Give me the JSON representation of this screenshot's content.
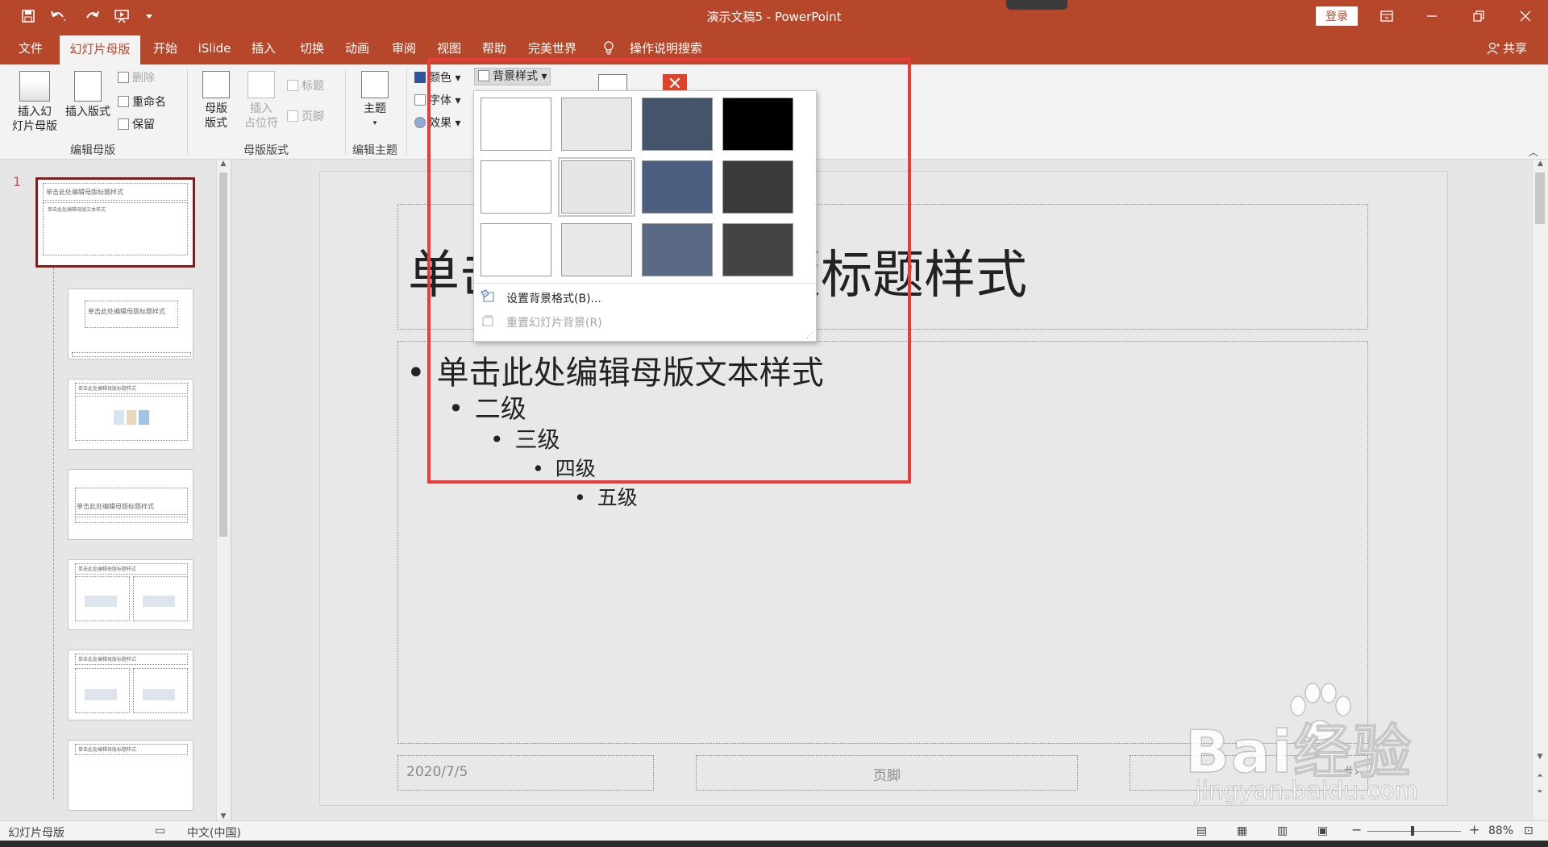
{
  "window": {
    "title": "演示文稿5 - PowerPoint",
    "login_label": "登录",
    "share_label": "共享"
  },
  "tabs": [
    {
      "label": "文件"
    },
    {
      "label": "幻灯片母版"
    },
    {
      "label": "开始"
    },
    {
      "label": "iSlide"
    },
    {
      "label": "插入"
    },
    {
      "label": "切换"
    },
    {
      "label": "动画"
    },
    {
      "label": "审阅"
    },
    {
      "label": "视图"
    },
    {
      "label": "帮助"
    },
    {
      "label": "完美世界"
    },
    {
      "label": "操作说明搜索"
    }
  ],
  "ribbon": {
    "insert_master": "插入幻\n灯片母版",
    "insert_layout": "插入版式",
    "delete": "删除",
    "rename": "重命名",
    "preserve": "保留",
    "group_edit_master": "编辑母版",
    "master_layout": "母版\n版式",
    "insert_placeholder": "插入\n占位符",
    "title_check": "标题",
    "footer_check": "页脚",
    "group_master_layout": "母版版式",
    "themes": "主题",
    "group_edit_theme": "编辑主题",
    "colors": "颜色",
    "fonts": "字体",
    "effects": "效果",
    "bg_styles": "背景样式"
  },
  "dropdown": {
    "swatch_colors": [
      [
        "#ffffff",
        "#e8e8e8",
        "#44546a",
        "#000000"
      ],
      [
        "#ffffff",
        "#e6e6e6",
        "#4d5f80",
        "#3a3a3a"
      ],
      [
        "#ffffff",
        "#e8e8e8",
        "#5a6a85",
        "#444444"
      ]
    ],
    "format_bg": "设置背景格式(B)...",
    "reset_bg": "重置幻灯片背景(R)"
  },
  "thumbnail": {
    "title_text": "单击此处编辑母版标题样式",
    "body_text": "单击此处编辑母版文本样式"
  },
  "slide": {
    "title": "单击此处编辑母版标题样式",
    "level1": "单击此处编辑母版文本样式",
    "level2": "二级",
    "level3": "三级",
    "level4": "四级",
    "level5": "五级",
    "date": "2020/7/5",
    "footer": "页脚",
    "page": "‹#›"
  },
  "status": {
    "view_name": "幻灯片母版",
    "language": "中文(中国)",
    "zoom": "88%"
  },
  "watermark": {
    "main": "Bai经验",
    "sub": "jingyan.baidu.com"
  },
  "colors": {
    "accent": "#b7472a",
    "highlight_frame": "#ea3b3b"
  }
}
